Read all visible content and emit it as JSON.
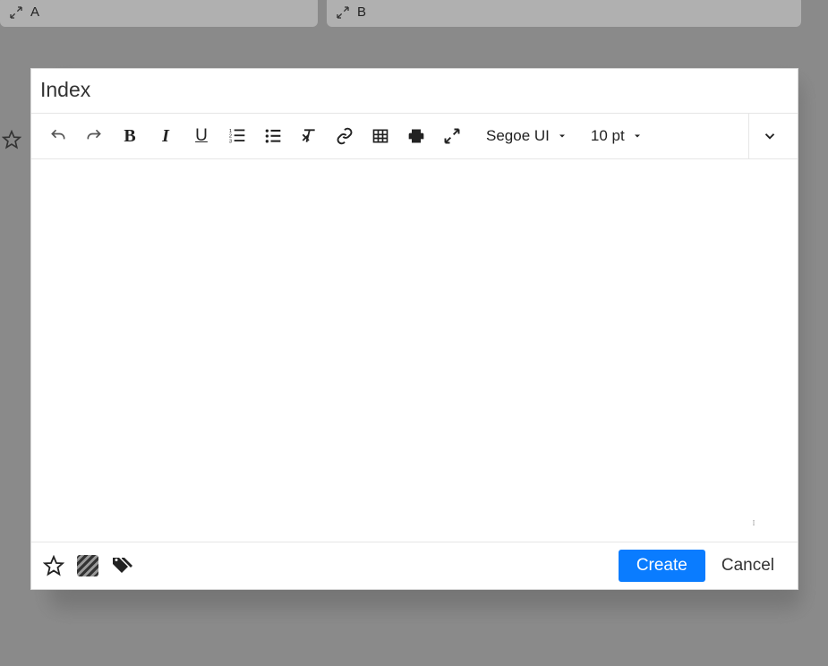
{
  "background": {
    "card_a_label": "A",
    "card_b_label": "B"
  },
  "modal": {
    "title": "Index",
    "toolbar": {
      "bold_glyph": "B",
      "italic_glyph": "I",
      "underline_glyph": "U",
      "font_family": "Segoe UI",
      "font_size": "10 pt"
    },
    "footer": {
      "create_label": "Create",
      "cancel_label": "Cancel"
    }
  }
}
